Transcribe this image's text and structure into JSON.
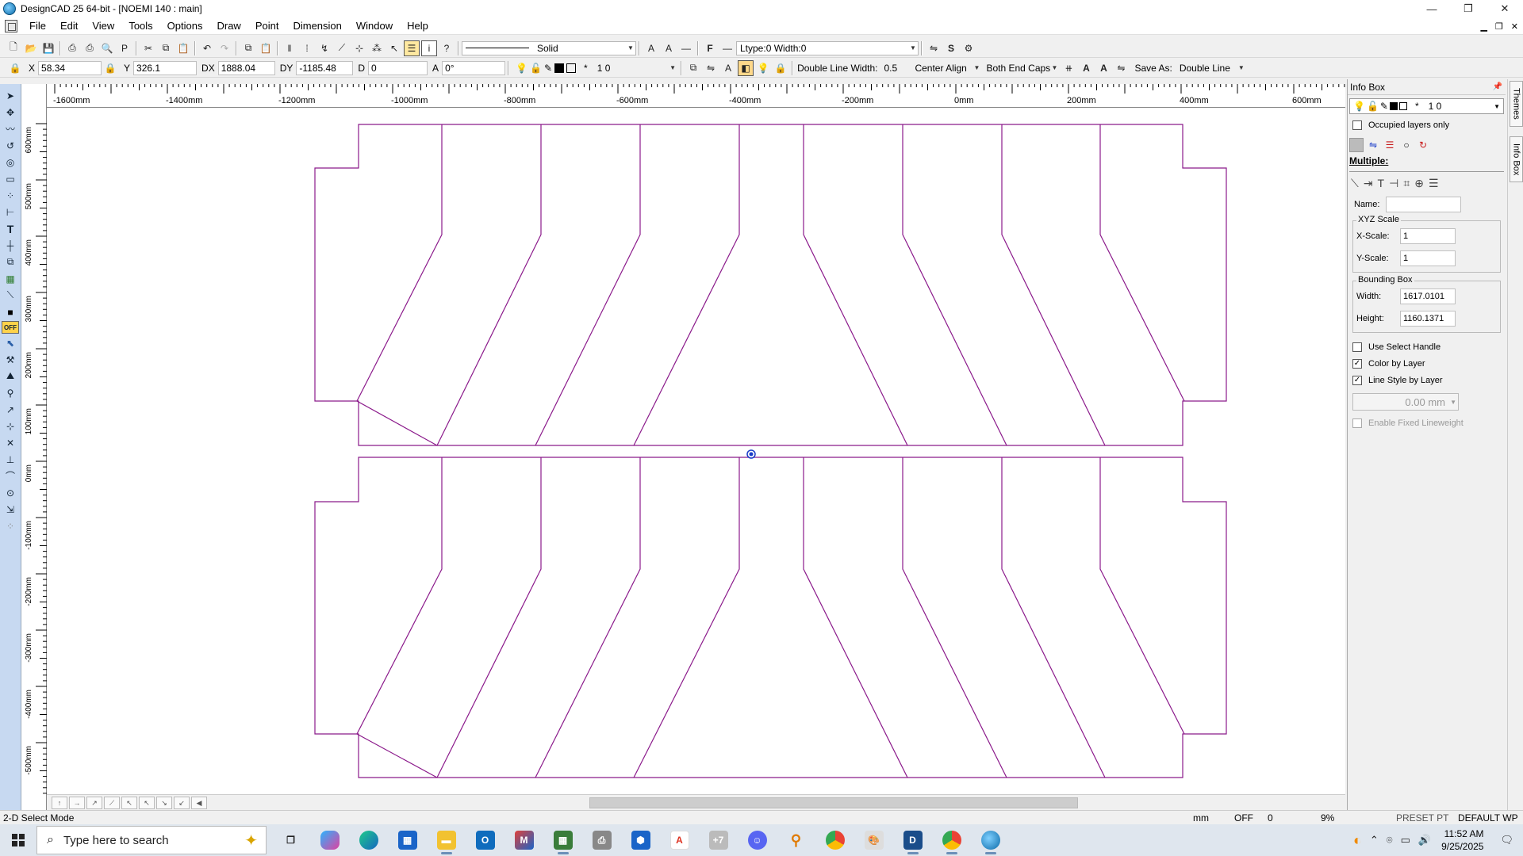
{
  "window": {
    "title": "DesignCAD 25 64-bit - [NOEMI 140 : main]",
    "controls": [
      "—",
      "❐",
      "✕"
    ]
  },
  "menu": [
    "File",
    "Edit",
    "View",
    "Tools",
    "Options",
    "Draw",
    "Point",
    "Dimension",
    "Window",
    "Help"
  ],
  "toolbar1": {
    "line_style": "Solid",
    "ltype": "Ltype:0  Width:0"
  },
  "toolbar2": {
    "x_label": "X",
    "x_value": "58.34",
    "y_label": "Y",
    "y_value": "326.1",
    "dx_label": "DX",
    "dx_value": "1888.04",
    "dy_label": "DY",
    "dy_value": "-1185.48",
    "d_label": "D",
    "d_value": "0",
    "a_label": "A",
    "a_value": "0°",
    "layer_star": "*",
    "layer_value": "1 0",
    "double_line_width_label": "Double Line Width:",
    "double_line_width_value": "0.5",
    "align": "Center Align",
    "end_caps": "Both End Caps",
    "save_as_label": "Save As:",
    "save_as_value": "Double Line"
  },
  "hruler_labels": [
    "-1600mm",
    "-1400mm",
    "-1200mm",
    "-1000mm",
    "-800mm",
    "-600mm",
    "-400mm",
    "-200mm",
    "0mm",
    "200mm",
    "400mm",
    "600mm"
  ],
  "vruler_labels": [
    "600mm",
    "500mm",
    "400mm",
    "300mm",
    "200mm",
    "100mm",
    "0mm",
    "-100mm",
    "-200mm",
    "-300mm",
    "-400mm",
    "-500mm"
  ],
  "infobox": {
    "title": "Info Box",
    "layer_star": "*",
    "layer_value": "1 0",
    "occupied_layers": "Occupied layers only",
    "multiple": "Multiple:",
    "name_label": "Name:",
    "name_value": "",
    "xyz_scale_title": "XYZ Scale",
    "x_scale_label": "X-Scale:",
    "x_scale_value": "1",
    "y_scale_label": "Y-Scale:",
    "y_scale_value": "1",
    "bbox_title": "Bounding Box",
    "width_label": "Width:",
    "width_value": "1617.0101",
    "height_label": "Height:",
    "height_value": "1160.1371",
    "use_select_handle": "Use Select Handle",
    "color_by_layer": "Color by Layer",
    "line_style_by_layer": "Line Style by Layer",
    "lineweight": "0.00 mm",
    "enable_fixed_lineweight": "Enable Fixed Lineweight",
    "side_tab_themes": "Themes",
    "side_tab_infobox": "Info Box"
  },
  "status": {
    "mode": "2-D Select Mode",
    "units": "mm",
    "snap": "OFF",
    "count": "0",
    "zoom": "9%",
    "preset": "PRESET PT",
    "wp": "DEFAULT WP"
  },
  "taskbar": {
    "search_placeholder": "Type here to search",
    "time": "11:52 AM",
    "date": "9/25/2025"
  },
  "colors": {
    "drawing_line": "#8b1a8b",
    "tool_strip": "#c7d9f1",
    "off_badge": "#ffd24a"
  }
}
